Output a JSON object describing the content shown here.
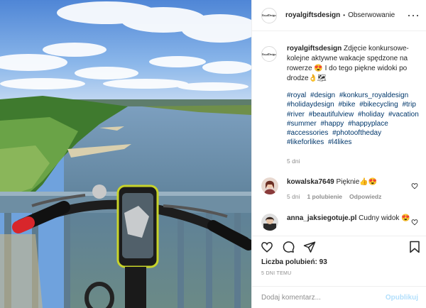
{
  "post": {
    "username": "royalgiftsdesign",
    "follow_label": "Obserwowanie",
    "separator": "•",
    "avatar_text": "RoyalDesign",
    "caption_text": "Zdjęcie konkursowe- kolejne aktywne wakacje spędzone na rowerze 😍 I do tego piękne widoki po drodze👌🗺",
    "hashtags": [
      "#royal",
      "#design",
      "#konkurs_royaldesign",
      "#holidaydesign",
      "#bike",
      "#bikecycling",
      "#trip",
      "#river",
      "#beautifulview",
      "#holiday",
      "#vacation",
      "#summer",
      "#happy",
      "#happyplace",
      "#accessories",
      "#photooftheday",
      "#likeforlikes",
      "#l4likes"
    ],
    "caption_time": "5 dni"
  },
  "comments": [
    {
      "username": "kowalska7649",
      "text": "Pięknie👍😍",
      "time": "5 dni",
      "likes_label": "1 polubienie",
      "reply_label": "Odpowiedz"
    },
    {
      "username": "anna_jaksiegotuje.pl",
      "text": "Cudny widok 😍"
    }
  ],
  "actions": {
    "likes_label": "Liczba polubień: 93",
    "days_ago": "5 DNI TEMU"
  },
  "comment_box": {
    "placeholder": "Dodaj komentarz...",
    "post_label": "Opublikuj"
  },
  "colors": {
    "link": "#00376b",
    "muted": "#8e8e8e",
    "post_button": "#b2dffc",
    "sky": "#6fa2dd",
    "river": "#5d7f9a",
    "holder_frame": "#c8d42a"
  }
}
